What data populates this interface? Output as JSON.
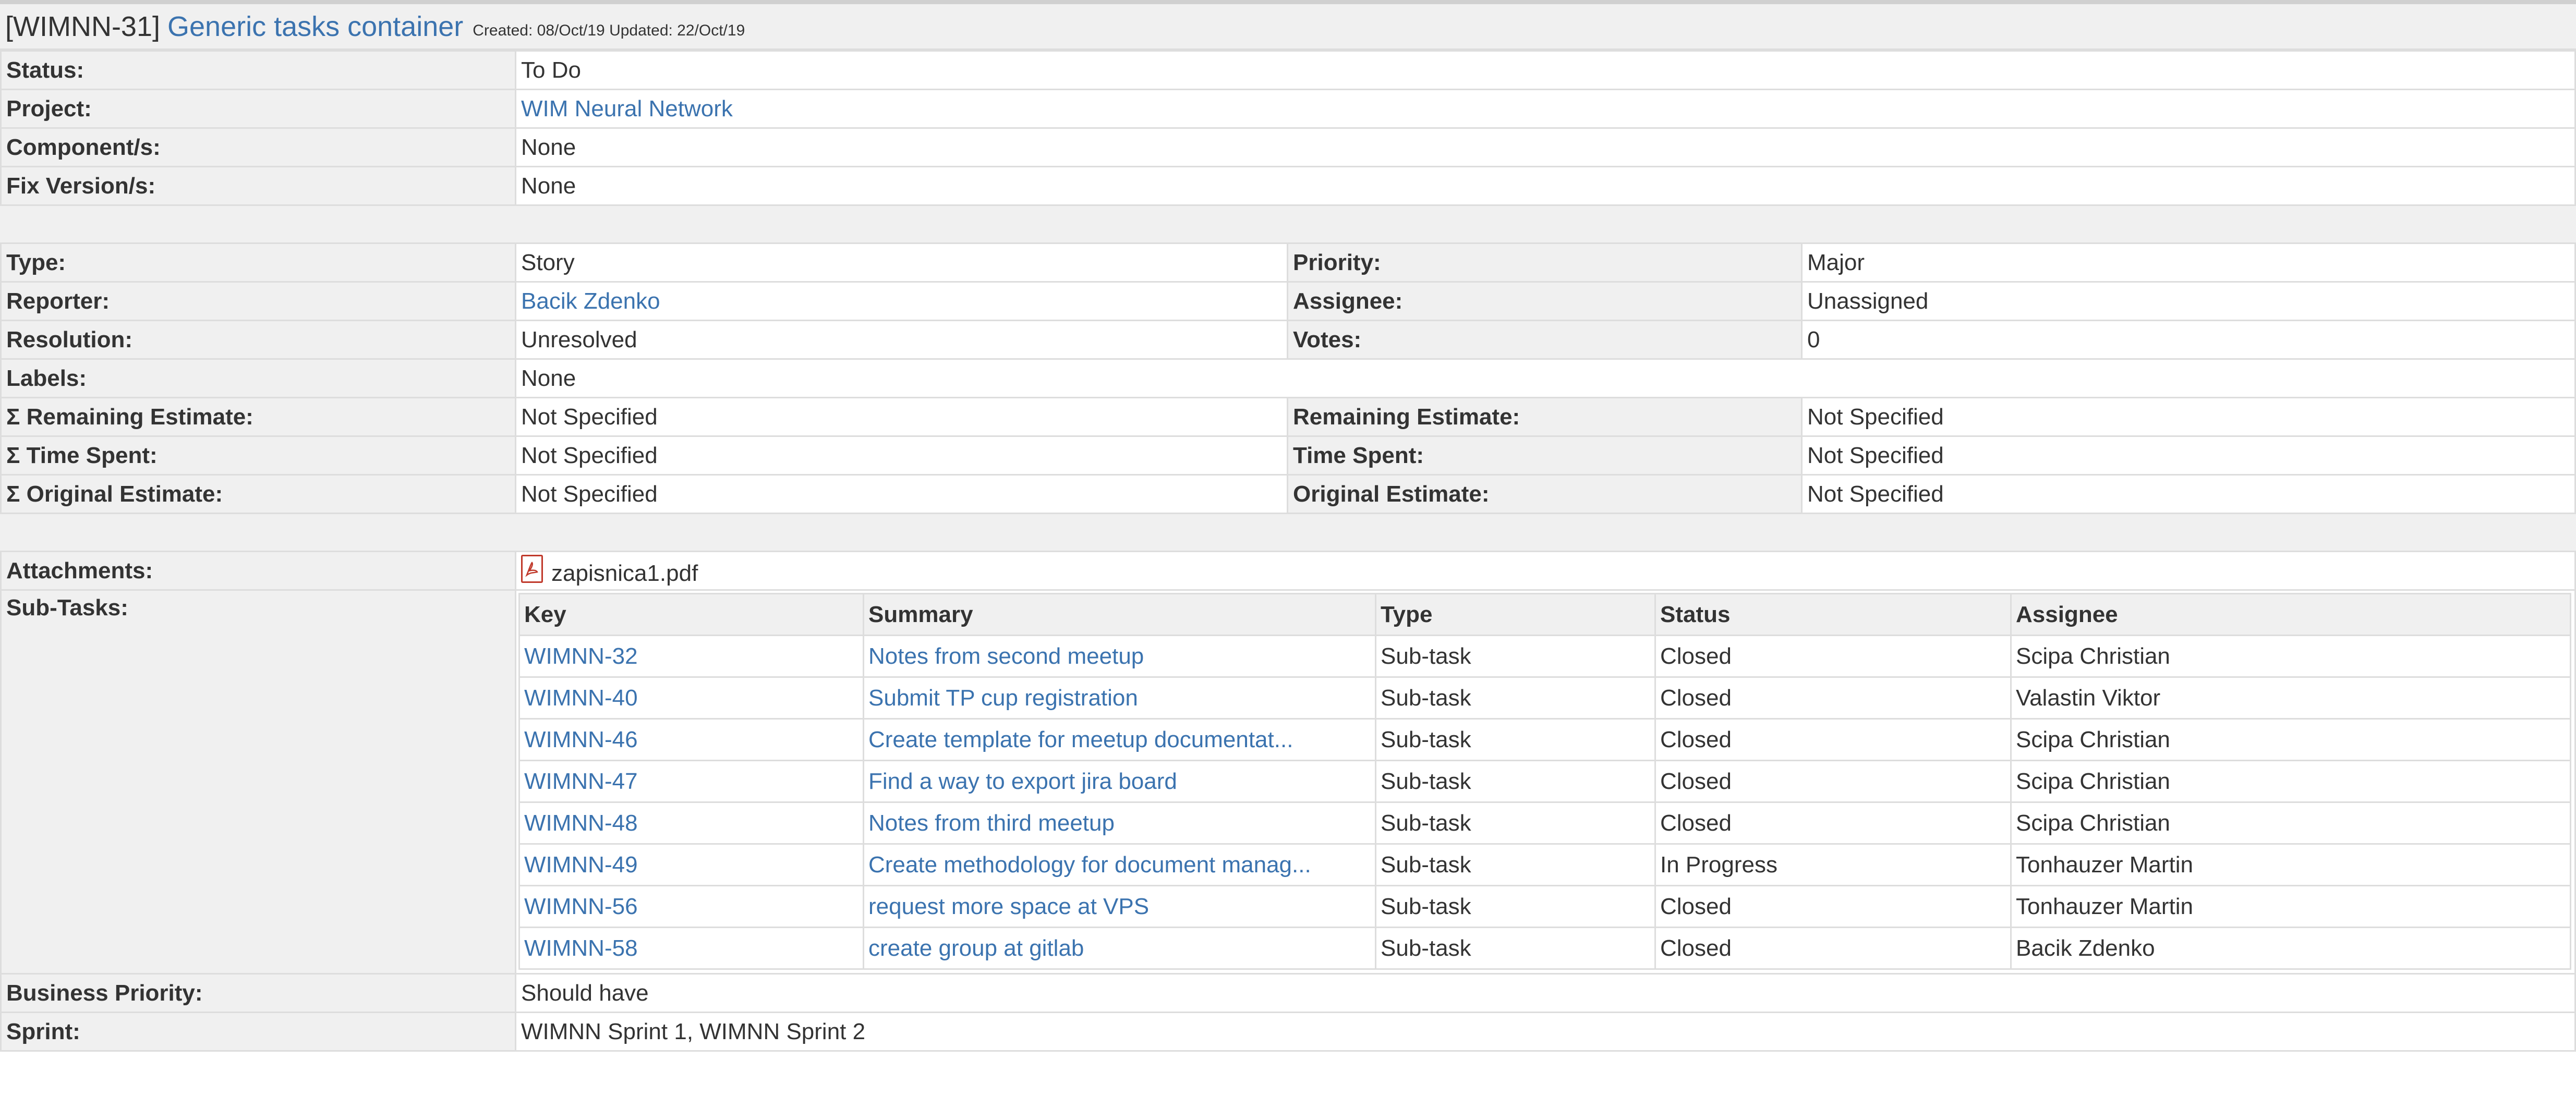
{
  "issue": {
    "key": "[WIMNN-31]",
    "title": "Generic tasks container",
    "meta": "Created: 08/Oct/19  Updated: 22/Oct/19"
  },
  "fields": {
    "status": {
      "label": "Status:",
      "value": "To Do"
    },
    "project": {
      "label": "Project:",
      "value": "WIM Neural Network"
    },
    "components": {
      "label": "Component/s:",
      "value": "None"
    },
    "fix_versions": {
      "label": "Fix Version/s:",
      "value": "None"
    },
    "type": {
      "label": "Type:",
      "value": "Story"
    },
    "priority": {
      "label": "Priority:",
      "value": "Major"
    },
    "reporter": {
      "label": "Reporter:",
      "value": "Bacik Zdenko"
    },
    "assignee": {
      "label": "Assignee:",
      "value": "Unassigned"
    },
    "resolution": {
      "label": "Resolution:",
      "value": "Unresolved"
    },
    "votes": {
      "label": "Votes:",
      "value": "0"
    },
    "labels": {
      "label": "Labels:",
      "value": "None"
    },
    "sum_remaining_estimate": {
      "label": "Σ Remaining Estimate:",
      "value": "Not Specified"
    },
    "remaining_estimate": {
      "label": "Remaining Estimate:",
      "value": "Not Specified"
    },
    "sum_time_spent": {
      "label": "Σ Time Spent:",
      "value": "Not Specified"
    },
    "time_spent": {
      "label": "Time Spent:",
      "value": "Not Specified"
    },
    "sum_original_estimate": {
      "label": "Σ Original Estimate:",
      "value": "Not Specified"
    },
    "original_estimate": {
      "label": "Original Estimate:",
      "value": "Not Specified"
    },
    "attachments": {
      "label": "Attachments:",
      "file": "zapisnica1.pdf",
      "icon": "pdf-file-icon"
    },
    "subtasks_label": "Sub-Tasks:",
    "business_priority": {
      "label": "Business Priority:",
      "value": "Should have"
    },
    "sprint": {
      "label": "Sprint:",
      "value": "WIMNN Sprint 1, WIMNN Sprint 2"
    }
  },
  "subtasks": {
    "headers": [
      "Key",
      "Summary",
      "Type",
      "Status",
      "Assignee"
    ],
    "rows": [
      [
        "WIMNN-32",
        "Notes from second meetup",
        "Sub-task",
        "Closed",
        "Scipa Christian"
      ],
      [
        "WIMNN-40",
        "Submit TP cup registration",
        "Sub-task",
        "Closed",
        "Valastin Viktor"
      ],
      [
        "WIMNN-46",
        "Create template for meetup documentat...",
        "Sub-task",
        "Closed",
        "Scipa Christian"
      ],
      [
        "WIMNN-47",
        "Find a way to export jira board",
        "Sub-task",
        "Closed",
        "Scipa Christian"
      ],
      [
        "WIMNN-48",
        "Notes from third meetup",
        "Sub-task",
        "Closed",
        "Scipa Christian"
      ],
      [
        "WIMNN-49",
        "Create methodology for document manag...",
        "Sub-task",
        "In Progress",
        "Tonhauzer Martin"
      ],
      [
        "WIMNN-56",
        "request more space at VPS",
        "Sub-task",
        "Closed",
        "Tonhauzer Martin"
      ],
      [
        "WIMNN-58",
        "create group at gitlab",
        "Sub-task",
        "Closed",
        "Bacik Zdenko"
      ]
    ]
  },
  "colors": {
    "link": "#3b73af",
    "label_bg": "#f0f0f0",
    "border": "#dddddd",
    "pdf_icon": "#c0392b"
  }
}
